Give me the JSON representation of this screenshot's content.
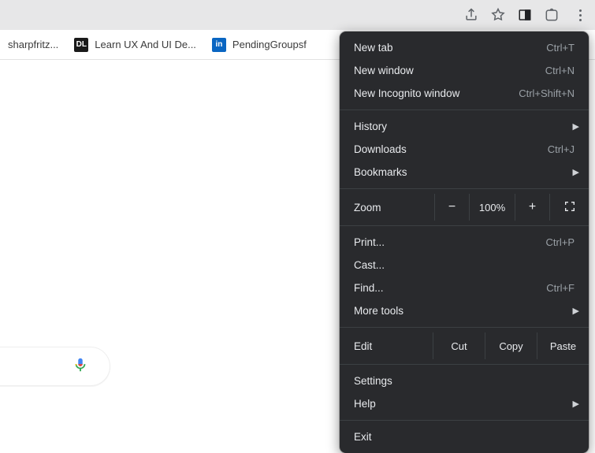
{
  "toolbar": {
    "icons": {
      "share": "share-icon",
      "star": "star-icon",
      "panel": "side-panel-icon",
      "ext": "extension-icon",
      "menu": "dots-vertical-icon"
    }
  },
  "bookmarks": [
    {
      "label": "sharpfritz...",
      "icon": "none"
    },
    {
      "label": "Learn UX And UI De...",
      "icon": "dl",
      "icon_text": "DL"
    },
    {
      "label": "PendingGroupsf",
      "icon": "in",
      "icon_text": "in"
    }
  ],
  "menu": {
    "newTab": {
      "label": "New tab",
      "accel": "Ctrl+T"
    },
    "newWindow": {
      "label": "New window",
      "accel": "Ctrl+N"
    },
    "newIncognito": {
      "label": "New Incognito window",
      "accel": "Ctrl+Shift+N"
    },
    "history": {
      "label": "History"
    },
    "downloads": {
      "label": "Downloads",
      "accel": "Ctrl+J"
    },
    "bookmarks": {
      "label": "Bookmarks"
    },
    "zoom": {
      "label": "Zoom",
      "minus": "−",
      "value": "100%",
      "plus": "+"
    },
    "print": {
      "label": "Print...",
      "accel": "Ctrl+P"
    },
    "cast": {
      "label": "Cast..."
    },
    "find": {
      "label": "Find...",
      "accel": "Ctrl+F"
    },
    "moreTools": {
      "label": "More tools"
    },
    "edit": {
      "label": "Edit",
      "cut": "Cut",
      "copy": "Copy",
      "paste": "Paste"
    },
    "settings": {
      "label": "Settings"
    },
    "help": {
      "label": "Help"
    },
    "exit": {
      "label": "Exit"
    }
  }
}
